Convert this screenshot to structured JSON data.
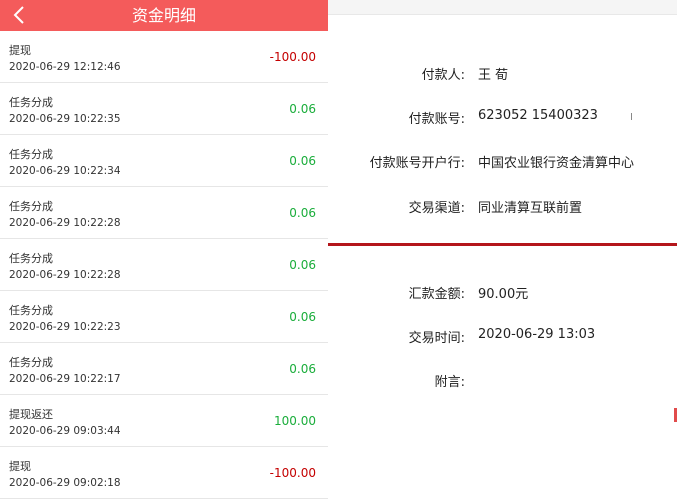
{
  "header": {
    "title": "资金明细",
    "back_icon": "chevron-left-icon"
  },
  "colors": {
    "header_bg": "#f45b5b",
    "negative": "#c40000",
    "positive": "#1aad3b",
    "divider": "#b4161b"
  },
  "records": [
    {
      "type": "提现",
      "time": "2020-06-29 12:12:46",
      "amount": "-100.00",
      "sign": "negative"
    },
    {
      "type": "任务分成",
      "time": "2020-06-29 10:22:35",
      "amount": "0.06",
      "sign": "positive"
    },
    {
      "type": "任务分成",
      "time": "2020-06-29 10:22:34",
      "amount": "0.06",
      "sign": "positive"
    },
    {
      "type": "任务分成",
      "time": "2020-06-29 10:22:28",
      "amount": "0.06",
      "sign": "positive"
    },
    {
      "type": "任务分成",
      "time": "2020-06-29 10:22:28",
      "amount": "0.06",
      "sign": "positive"
    },
    {
      "type": "任务分成",
      "time": "2020-06-29 10:22:23",
      "amount": "0.06",
      "sign": "positive"
    },
    {
      "type": "任务分成",
      "time": "2020-06-29 10:22:17",
      "amount": "0.06",
      "sign": "positive"
    },
    {
      "type": "提现返还",
      "time": "2020-06-29 09:03:44",
      "amount": "100.00",
      "sign": "positive"
    },
    {
      "type": "提现",
      "time": "2020-06-29 09:02:18",
      "amount": "-100.00",
      "sign": "negative"
    }
  ],
  "detail": {
    "payer": {
      "label": "付款人:",
      "value": "王  荀"
    },
    "account": {
      "label": "付款账号:",
      "value": "623052 15400323"
    },
    "bank": {
      "label": "付款账号开户行:",
      "value": "中国农业银行资金清算中心"
    },
    "channel": {
      "label": "交易渠道:",
      "value": "同业清算互联前置"
    },
    "amount": {
      "label": "汇款金额:",
      "value": "90.00元"
    },
    "time": {
      "label": "交易时间:",
      "value": "2020-06-29 13:03"
    },
    "note": {
      "label": "附言:",
      "value": ""
    }
  }
}
